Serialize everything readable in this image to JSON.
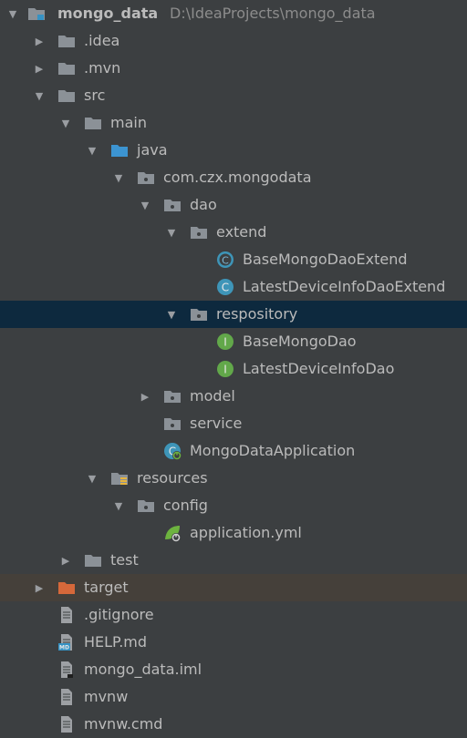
{
  "project": {
    "name": "mongo_data",
    "path": "D:\\IdeaProjects\\mongo_data"
  },
  "tree": [
    {
      "label": "mongo_data",
      "depth": 0,
      "arrow": "down",
      "icon": "module-folder-icon"
    },
    {
      "label": ".idea",
      "depth": 1,
      "arrow": "right",
      "icon": "folder-icon"
    },
    {
      "label": ".mvn",
      "depth": 1,
      "arrow": "right",
      "icon": "folder-icon"
    },
    {
      "label": "src",
      "depth": 1,
      "arrow": "down",
      "icon": "folder-icon"
    },
    {
      "label": "main",
      "depth": 2,
      "arrow": "down",
      "icon": "folder-icon"
    },
    {
      "label": "java",
      "depth": 3,
      "arrow": "down",
      "icon": "source-folder-icon"
    },
    {
      "label": "com.czx.mongodata",
      "depth": 4,
      "arrow": "down",
      "icon": "package-icon"
    },
    {
      "label": "dao",
      "depth": 5,
      "arrow": "down",
      "icon": "package-icon"
    },
    {
      "label": "extend",
      "depth": 6,
      "arrow": "down",
      "icon": "package-icon"
    },
    {
      "label": "BaseMongoDaoExtend",
      "depth": 7,
      "arrow": "none",
      "icon": "abstract-class-icon"
    },
    {
      "label": "LatestDeviceInfoDaoExtend",
      "depth": 7,
      "arrow": "none",
      "icon": "class-icon"
    },
    {
      "label": "respository",
      "depth": 6,
      "arrow": "down",
      "icon": "package-icon",
      "selected": true
    },
    {
      "label": "BaseMongoDao",
      "depth": 7,
      "arrow": "none",
      "icon": "interface-icon"
    },
    {
      "label": "LatestDeviceInfoDao",
      "depth": 7,
      "arrow": "none",
      "icon": "interface-icon"
    },
    {
      "label": "model",
      "depth": 5,
      "arrow": "right",
      "icon": "package-icon"
    },
    {
      "label": "service",
      "depth": 5,
      "arrow": "none",
      "icon": "package-icon"
    },
    {
      "label": "MongoDataApplication",
      "depth": 5,
      "arrow": "none",
      "icon": "spring-boot-class-icon"
    },
    {
      "label": "resources",
      "depth": 3,
      "arrow": "down",
      "icon": "resources-folder-icon"
    },
    {
      "label": "config",
      "depth": 4,
      "arrow": "down",
      "icon": "package-icon"
    },
    {
      "label": "application.yml",
      "depth": 5,
      "arrow": "none",
      "icon": "spring-config-icon"
    },
    {
      "label": "test",
      "depth": 2,
      "arrow": "right",
      "icon": "folder-icon"
    },
    {
      "label": "target",
      "depth": 1,
      "arrow": "right",
      "icon": "excluded-folder-icon",
      "excluded": true
    },
    {
      "label": ".gitignore",
      "depth": 1,
      "arrow": "none",
      "icon": "text-file-icon"
    },
    {
      "label": "HELP.md",
      "depth": 1,
      "arrow": "none",
      "icon": "markdown-file-icon"
    },
    {
      "label": "mongo_data.iml",
      "depth": 1,
      "arrow": "none",
      "icon": "iml-file-icon"
    },
    {
      "label": "mvnw",
      "depth": 1,
      "arrow": "none",
      "icon": "text-file-icon"
    },
    {
      "label": "mvnw.cmd",
      "depth": 1,
      "arrow": "none",
      "icon": "text-file-icon"
    }
  ],
  "colors": {
    "background": "#3c3f41",
    "selection": "#0d293e",
    "excluded_row": "#45403a",
    "folder": "#8b9197",
    "source_folder": "#3c94d1",
    "excluded_folder": "#d6683a",
    "class": "#3e95b8",
    "interface": "#62a84a",
    "spring": "#6db33f"
  }
}
